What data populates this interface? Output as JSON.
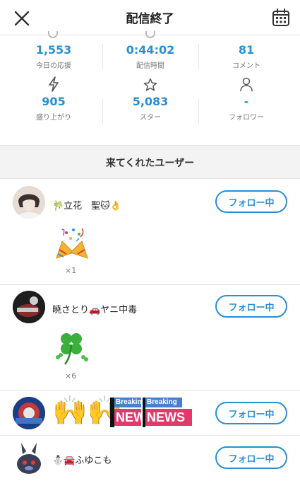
{
  "header": {
    "title": "配信終了",
    "close_icon": "close-icon",
    "calendar_icon": "calendar-icon"
  },
  "stats": [
    {
      "value": "1,553",
      "label": "今日の応援"
    },
    {
      "value": "0:44:02",
      "label": "配信時間"
    },
    {
      "value": "81",
      "label": "コメント"
    },
    {
      "value": "905",
      "label": "盛り上がり",
      "icon": "lightning-icon"
    },
    {
      "value": "5,083",
      "label": "スター",
      "icon": "star-icon"
    },
    {
      "value": "-",
      "label": "フォロワー",
      "icon": "person-icon"
    }
  ],
  "section": {
    "title": "来てくれたユーザー"
  },
  "users": [
    {
      "name": "🎋立花　聖🐱👌",
      "follow_label": "フォロー中",
      "gift": "party-popper-gift",
      "gift_count": "×1"
    },
    {
      "name": "暁さとり🚗ヤニ中毒",
      "follow_label": "フォロー中",
      "gift": "four-leaf-clover-gift",
      "gift_count": "×6"
    },
    {
      "name": "🙌🙌",
      "banner_text_1": "Breaking",
      "banner_text_2": "NEWS",
      "follow_label": "フォロー中"
    },
    {
      "name": "⛄🚘ふゆこも",
      "follow_label": "フォロー中"
    }
  ],
  "colors": {
    "accent": "#2a8fd0",
    "divider": "#e3e3e3",
    "section_bg": "#f3f3f3"
  }
}
